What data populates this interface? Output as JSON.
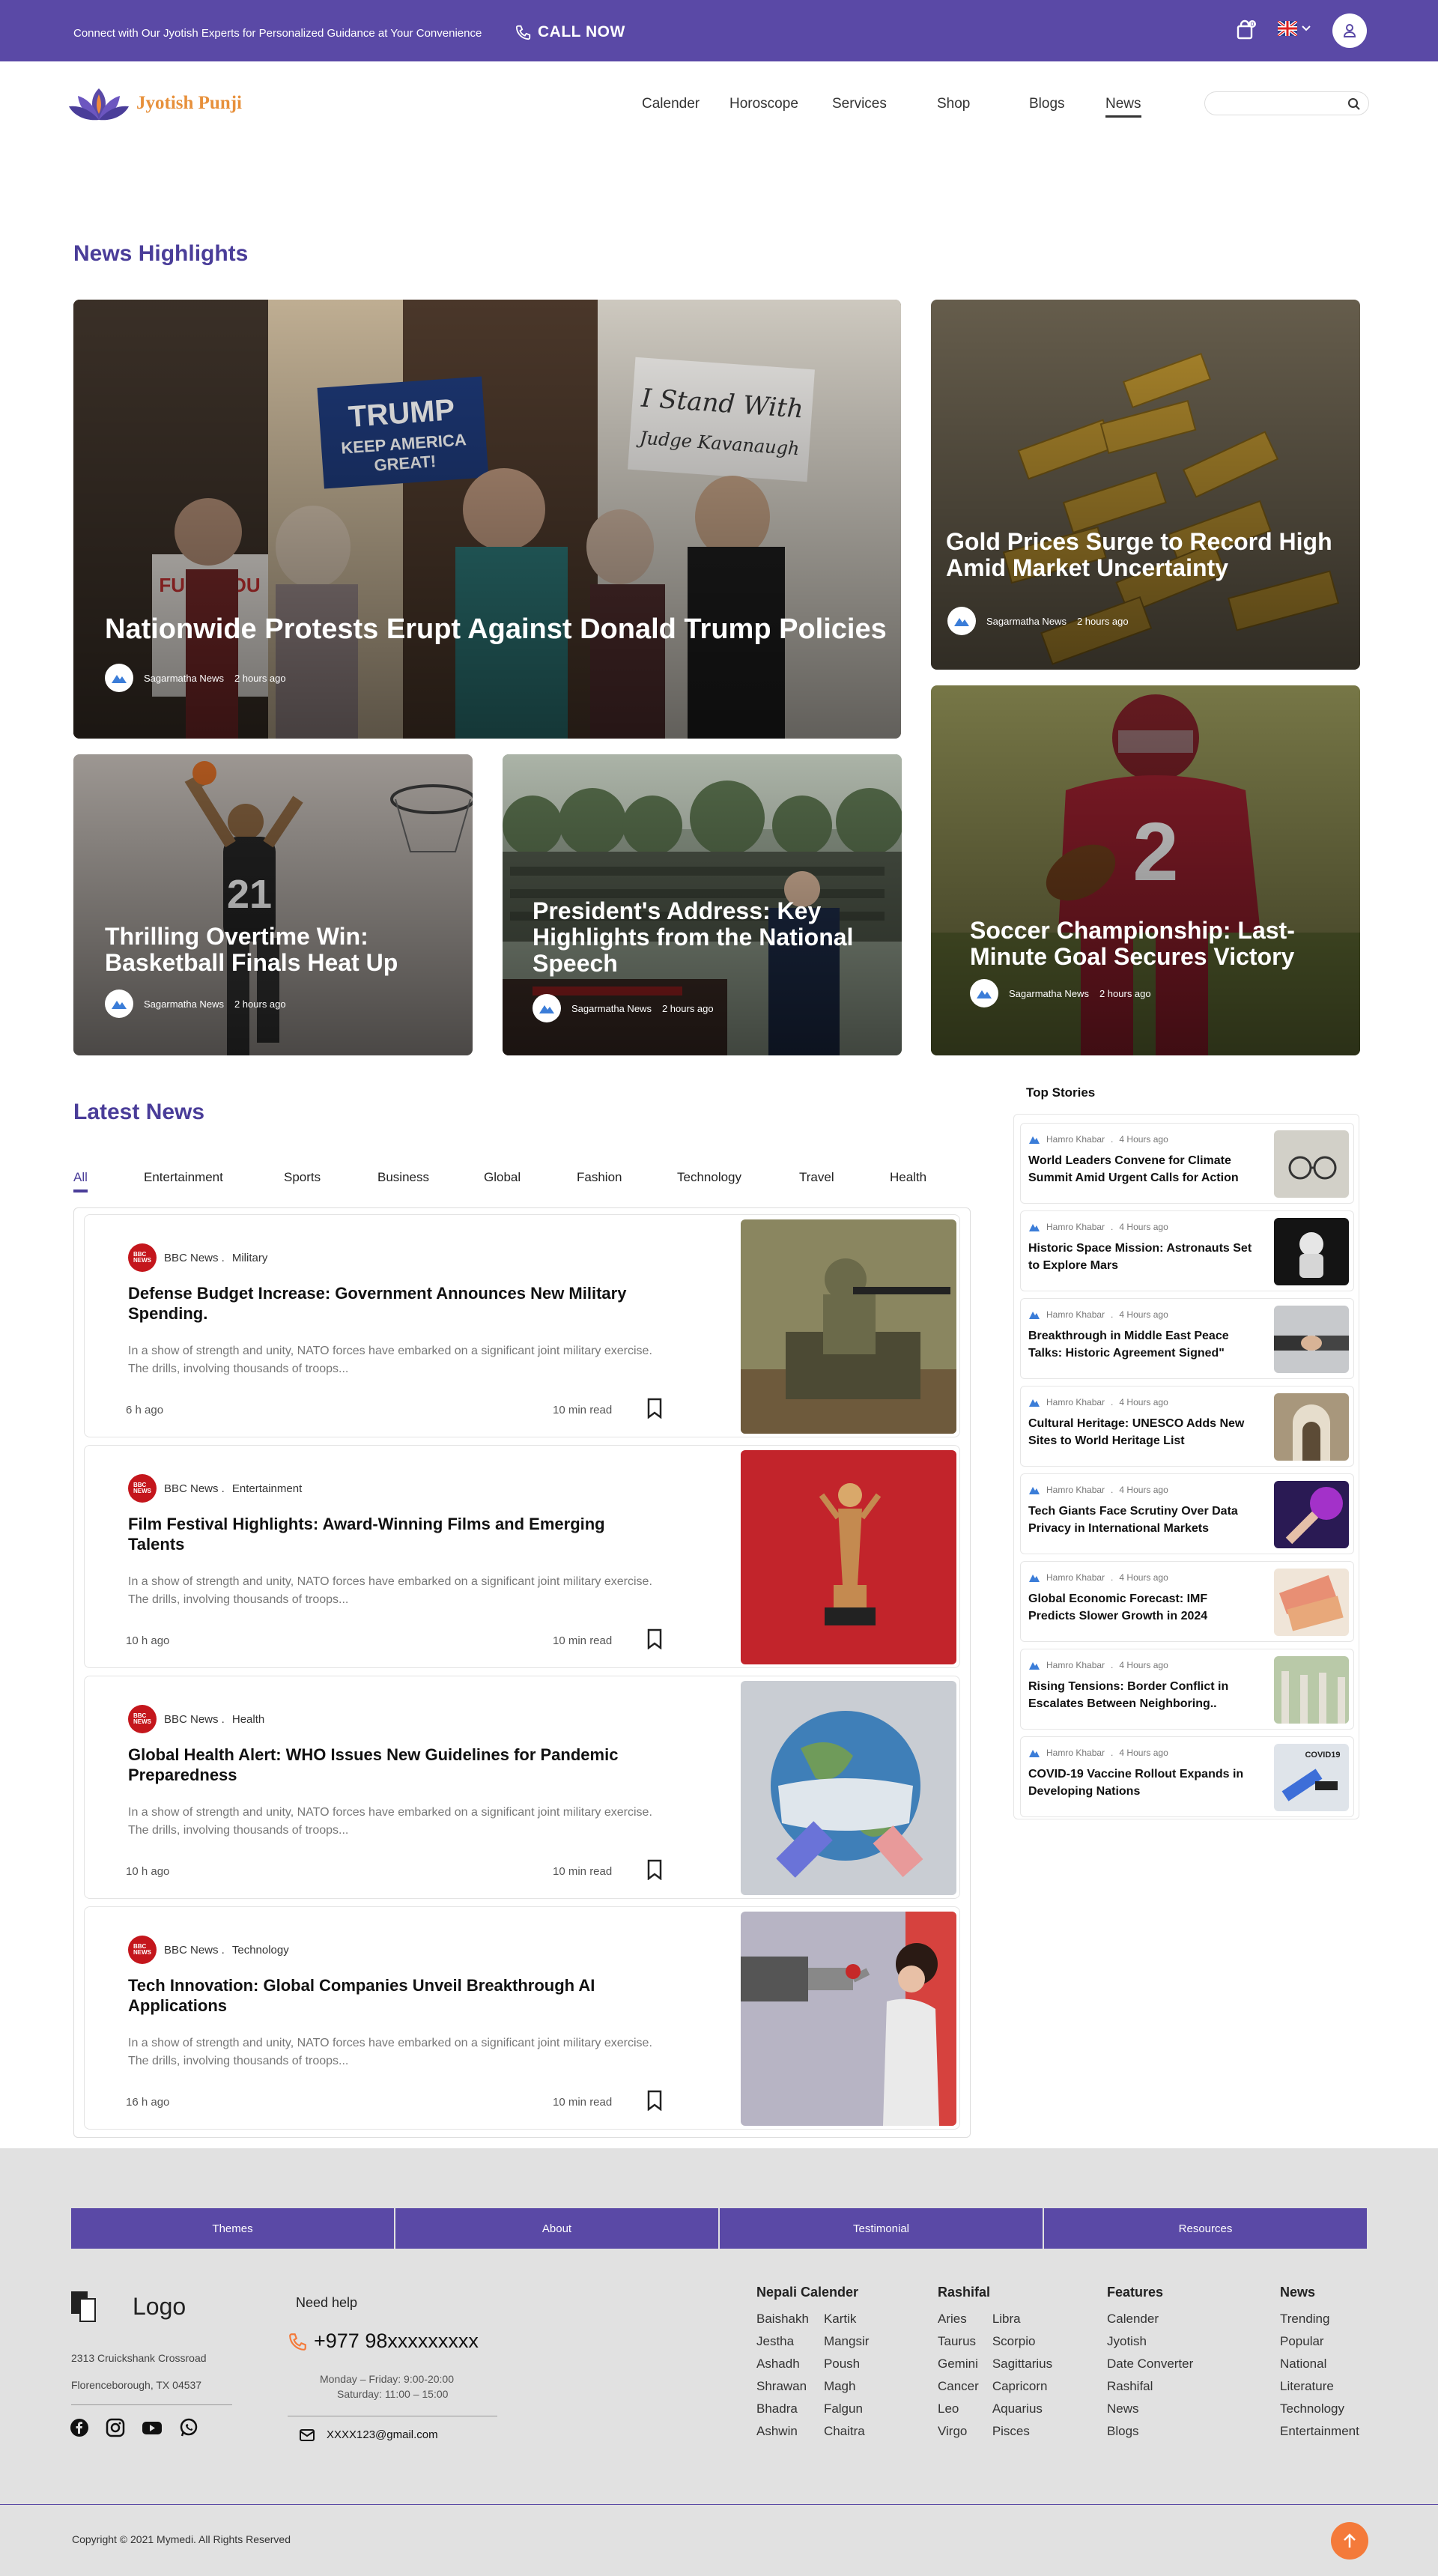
{
  "topbar": {
    "tagline": "Connect with Our Jyotish Experts for Personalized Guidance at Your Convenience",
    "call": "CALL NOW",
    "cart_count": "0"
  },
  "brand": {
    "name": "Jyotish Punji"
  },
  "nav": [
    "Calender",
    "Horoscope",
    "Services",
    "Shop",
    "Blogs",
    "News"
  ],
  "highlights": {
    "title": "News Highlights",
    "cards": [
      {
        "title": "Nationwide Protests Erupt Against Donald Trump Policies",
        "source": "Sagarmatha News",
        "time": "2 hours ago",
        "sign1": "TRUMP KEEP AMERICA GREAT! 2020",
        "sign2": "I Stand With Judge Kavanaugh",
        "sign3": "FUCK YOU TRUMP"
      },
      {
        "title": "Gold Prices Surge to Record High Amid Market Uncertainty",
        "source": "Sagarmatha News",
        "time": "2 hours ago"
      },
      {
        "title": "Thrilling Overtime Win: Basketball Finals Heat Up",
        "source": "Sagarmatha News",
        "time": "2 hours ago"
      },
      {
        "title": "President's Address: Key Highlights from the National Speech",
        "source": "Sagarmatha News",
        "time": "2 hours ago"
      },
      {
        "title": "Soccer Championship: Last-Minute Goal Secures Victory",
        "source": "Sagarmatha News",
        "time": "2 hours ago"
      }
    ]
  },
  "latest": {
    "title": "Latest News",
    "tabs": [
      "All",
      "Entertainment",
      "Sports",
      "Business",
      "Global",
      "Fashion",
      "Technology",
      "Travel",
      "Health"
    ],
    "items": [
      {
        "source": "BBC News .",
        "category": "Military",
        "title": "Defense Budget Increase: Government Announces New Military Spending.",
        "desc": "In a show of strength and unity, NATO forces have embarked on a significant joint military exercise. The drills, involving thousands of troops...",
        "ago": "6 h ago",
        "read": "10 min read"
      },
      {
        "source": "BBC News .",
        "category": "Entertainment",
        "title": "Film Festival Highlights: Award-Winning Films and Emerging Talents",
        "desc": "In a show of strength and unity, NATO forces have embarked on a significant joint military exercise. The drills, involving thousands of troops...",
        "ago": "10 h ago",
        "read": "10 min read"
      },
      {
        "source": "BBC News .",
        "category": "Health",
        "title": "Global Health Alert: WHO Issues New Guidelines for Pandemic Preparedness",
        "desc": "In a show of strength and unity, NATO forces have embarked on a significant joint military exercise. The drills, involving thousands of troops...",
        "ago": "10 h ago",
        "read": "10 min read"
      },
      {
        "source": "BBC News .",
        "category": "Technology",
        "title": "Tech Innovation: Global Companies Unveil Breakthrough AI Applications",
        "desc": "In a show of strength and unity, NATO forces have embarked on a significant joint military exercise. The drills, involving thousands of troops...",
        "ago": "16 h ago",
        "read": "10 min read"
      }
    ]
  },
  "top_stories": {
    "title": "Top Stories",
    "items": [
      {
        "source": "Hamro Khabar",
        "time": "4 Hours ago",
        "title": "World Leaders Convene for Climate Summit Amid Urgent Calls for Action"
      },
      {
        "source": "Hamro Khabar",
        "time": "4 Hours ago",
        "title": "Historic Space Mission: Astronauts Set to Explore Mars"
      },
      {
        "source": "Hamro Khabar",
        "time": "4 Hours ago",
        "title": "Breakthrough in Middle East Peace Talks: Historic Agreement Signed\""
      },
      {
        "source": "Hamro Khabar",
        "time": "4 Hours ago",
        "title": "Cultural Heritage: UNESCO Adds New Sites to World Heritage List"
      },
      {
        "source": "Hamro Khabar",
        "time": "4 Hours ago",
        "title": "Tech Giants Face Scrutiny Over Data Privacy in International Markets"
      },
      {
        "source": "Hamro Khabar",
        "time": "4 Hours ago",
        "title": "Global Economic Forecast: IMF Predicts Slower Growth in 2024"
      },
      {
        "source": "Hamro Khabar",
        "time": "4 Hours ago",
        "title": "Rising Tensions: Border Conflict in Escalates Between Neighboring.."
      },
      {
        "source": "Hamro Khabar",
        "time": "4 Hours ago",
        "title": "COVID-19 Vaccine Rollout Expands in Developing Nations",
        "badge": "COVID19"
      }
    ]
  },
  "footer": {
    "tabs": [
      "Themes",
      "About",
      "Testimonial",
      "Resources"
    ],
    "logo": "Logo",
    "address1": "2313 Cruickshank Crossroad",
    "address2": "Florenceborough, TX 04537",
    "help": "Need help",
    "phone": "+977 98xxxxxxxxx",
    "hours1": "Monday – Friday: 9:00-20:00",
    "hours2": "Saturday: 11:00 – 15:00",
    "email": "XXXX123@gmail.com",
    "cols": {
      "nepali": {
        "title": "Nepali Calender",
        "a": [
          "Baishakh",
          "Jestha",
          "Ashadh",
          "Shrawan",
          "Bhadra",
          "Ashwin"
        ],
        "b": [
          "Kartik",
          "Mangsir",
          "Poush",
          "Magh",
          "Falgun",
          "Chaitra"
        ]
      },
      "rashifal": {
        "title": "Rashifal",
        "a": [
          "Aries",
          "Taurus",
          "Gemini",
          "Cancer",
          "Leo",
          "Virgo"
        ],
        "b": [
          "Libra",
          "Scorpio",
          "Sagittarius",
          "Capricorn",
          "Aquarius",
          "Pisces"
        ]
      },
      "features": {
        "title": "Features",
        "items": [
          "Calender",
          "Jyotish",
          "Date Converter",
          "Rashifal",
          "News",
          "Blogs"
        ]
      },
      "news": {
        "title": "News",
        "items": [
          "Trending",
          "Popular",
          "National",
          "Literature",
          "Technology",
          "Entertainment"
        ]
      }
    },
    "copyright": "Copyright © 2021 Mymedi. All Rights Reserved"
  },
  "colors": {
    "primary": "#5a49a6",
    "accent": "#f47a3a",
    "bbc": "#c4161c"
  }
}
